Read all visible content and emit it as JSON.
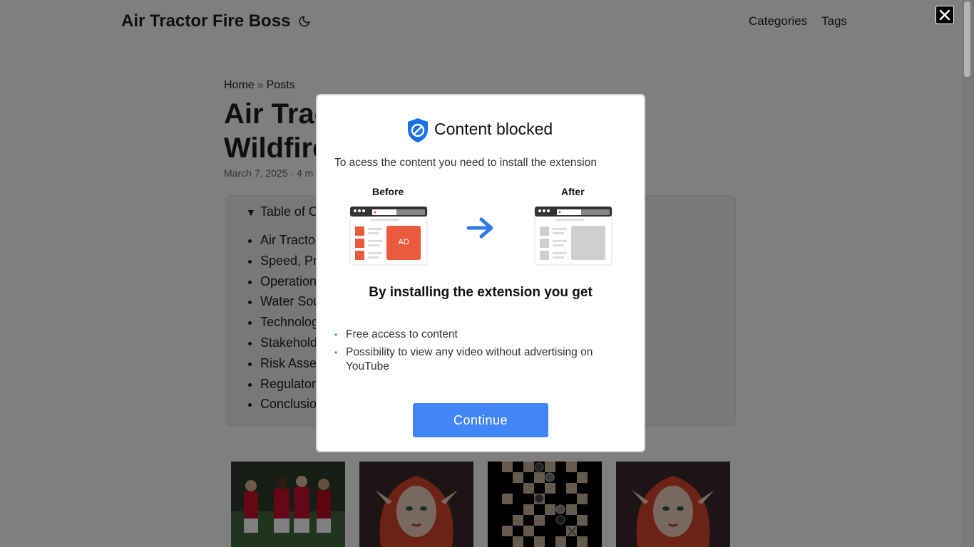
{
  "header": {
    "site_title": "Air Tractor Fire Boss",
    "nav": [
      "Categories",
      "Tags"
    ]
  },
  "breadcrumb": [
    "Home",
    "Posts"
  ],
  "post": {
    "title_line1": "Air Trac",
    "title_line2": "Wildfire",
    "meta": "March 7, 2025 · 4 m"
  },
  "toc": {
    "summary": "Table of C",
    "items": [
      "Air Tractor",
      "Speed, Pr",
      "Operation",
      "Water Sou",
      "Technolog",
      "Stakehold",
      "Risk Asse",
      "Regulator",
      "Conclusio"
    ]
  },
  "thumbnails": [
    {
      "name": "football-players-image",
      "accent": "#c8102e"
    },
    {
      "name": "fantasy-elf-portrait-image",
      "accent": "#d9462a"
    },
    {
      "name": "board-game-grid-image",
      "accent": "#000000"
    },
    {
      "name": "fantasy-elf-portrait-image-2",
      "accent": "#d9462a"
    }
  ],
  "modal": {
    "title": "Content blocked",
    "description": "To acess the content you need to install the extension",
    "before_label": "Before",
    "after_label": "After",
    "ad_label": "AD",
    "subheading": "By installing the extension you get",
    "benefits": [
      "Free access to content",
      "Possibility to view any video without advertising on YouTube"
    ],
    "cta": "Continue",
    "accent": "#4285f4",
    "shield_color": "#1a73e8",
    "ad_color": "#ea5a3c"
  },
  "icons": {
    "theme": "moon-icon",
    "close": "close-icon",
    "shield": "shield-block-icon",
    "arrow": "arrow-right-icon"
  }
}
